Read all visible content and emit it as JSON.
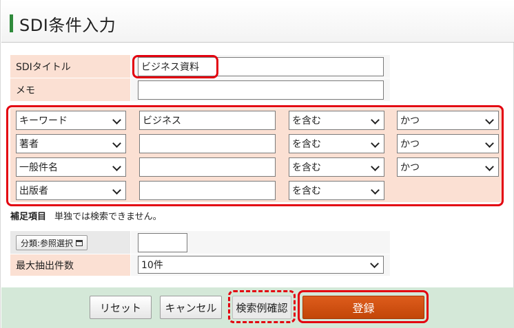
{
  "header": {
    "title": "SDI条件入力"
  },
  "sdi": {
    "title_label": "SDIタイトル",
    "title_value": "ビジネス資料",
    "memo_label": "メモ",
    "memo_value": ""
  },
  "conditions": [
    {
      "field": "キーワード",
      "value": "ビジネス",
      "match": "を含む",
      "logic": "かつ"
    },
    {
      "field": "著者",
      "value": "",
      "match": "を含む",
      "logic": "かつ"
    },
    {
      "field": "一般件名",
      "value": "",
      "match": "を含む",
      "logic": "かつ"
    },
    {
      "field": "出版者",
      "value": "",
      "match": "を含む",
      "logic": ""
    }
  ],
  "supplement": {
    "heading": "補足項目",
    "note": "単独では検索できません。",
    "classification_button": "分類:参照選択",
    "classification_value": "",
    "max_label": "最大抽出件数",
    "max_value": "10件"
  },
  "buttons": {
    "reset": "リセット",
    "cancel": "キャンセル",
    "example": "検索例確認",
    "register": "登録"
  },
  "colors": {
    "accent_green": "#2f8a3b",
    "label_bg": "#fbe0d3",
    "footer_bg": "#d4e8d8",
    "primary": "#c24608",
    "highlight_red": "#e3000f"
  }
}
